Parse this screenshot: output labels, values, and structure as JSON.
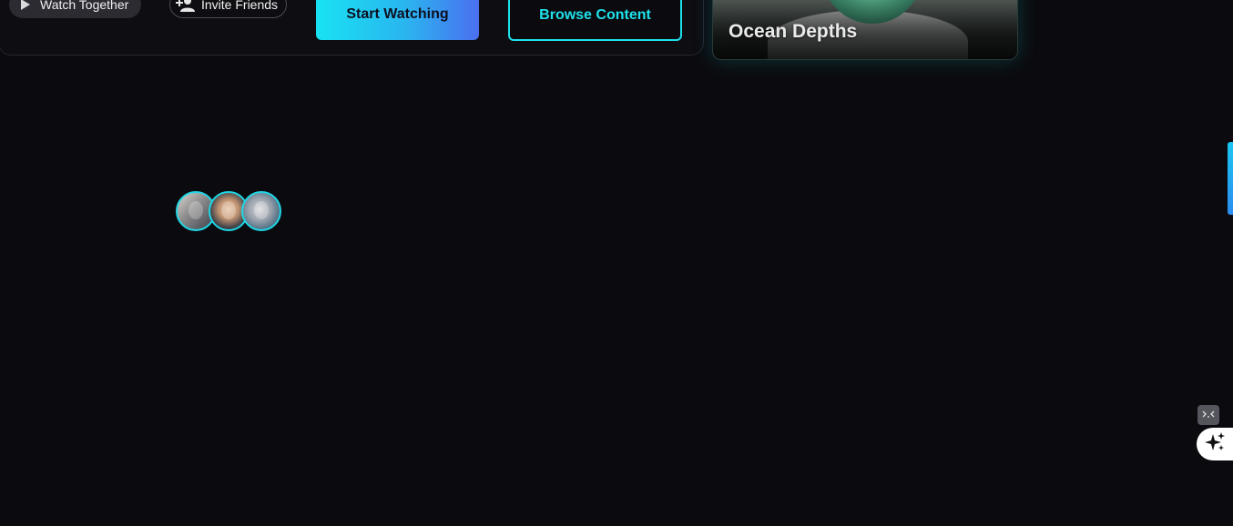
{
  "hero": {
    "watch_together_label": "Watch Together",
    "invite_friends_label": "Invite Friends",
    "start_watching_label": "Start Watching",
    "browse_content_label": "Browse Content"
  },
  "featured_card": {
    "title": "Ocean Depths"
  },
  "viewers": {
    "avatars": [
      "avatar-1",
      "avatar-2",
      "avatar-3"
    ]
  },
  "icons": {
    "play": "play-icon",
    "add_user": "add-user-icon",
    "devtools": "devtools-icon",
    "sparkle": "sparkle-icon"
  },
  "colors": {
    "background": "#0b0b0f",
    "accent_cyan": "#1fe0ea",
    "gradient_start": "#18e2f2",
    "gradient_end": "#4b6ff0"
  }
}
